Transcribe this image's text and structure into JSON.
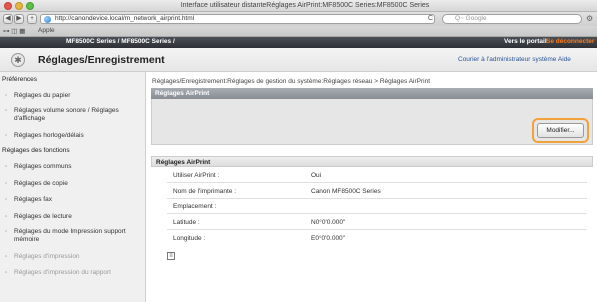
{
  "window": {
    "title": "Interface utilisateur distanteRéglages AirPrint:MF8500C Series:MF8500C Series"
  },
  "browser": {
    "back": "◀",
    "forward": "▶",
    "add": "+",
    "url": "http://canondevice.local/m_network_airprint.html",
    "reload": "C",
    "search_placeholder": "Q~ Google",
    "bookmarks": [
      "Apple"
    ]
  },
  "header": {
    "product": "MF8500C Series / MF8500C Series /",
    "portal_link": "Vers le portail",
    "logout_link": "Se déconnecter"
  },
  "page": {
    "title": "Réglages/Enregistrement",
    "admin_link": "Courier à l'administrateur système",
    "help_link": "Aide"
  },
  "sidebar": {
    "preferences_title": "Préférences",
    "preferences": [
      "Réglages du papier",
      "Réglages volume sonore / Réglages d'affichage",
      "Réglages horloge/délais"
    ],
    "functions_title": "Réglages des fonctions",
    "functions": [
      "Réglages communs",
      "Réglages de copie",
      "Réglages fax",
      "Réglages de lecture",
      "Réglages du mode Impression support mémoire",
      "Réglages d'impression",
      "Réglages d'impression du rapport"
    ]
  },
  "breadcrumb": "Réglages/Enregistrement:Réglages de gestion du système:Réglages réseau > Réglages AirPrint",
  "main": {
    "panel_title": "Réglages AirPrint",
    "modify_button": "Modifier...",
    "section_title": "Réglages AirPrint",
    "rows": [
      {
        "label": "Utiliser AirPrint :",
        "value": "Oui"
      },
      {
        "label": "Nom de l'imprimante :",
        "value": "Canon MF8500C Series"
      },
      {
        "label": "Emplacement :",
        "value": ""
      },
      {
        "label": "Latitude :",
        "value": "N0°0'0.000\""
      },
      {
        "label": "Longitude :",
        "value": "E0°0'0.000\""
      }
    ]
  },
  "colors": {
    "header_bar": "#2d3136",
    "logout": "#ff7a1a",
    "highlight": "#f2a23a",
    "panel_header": "#878c93"
  }
}
